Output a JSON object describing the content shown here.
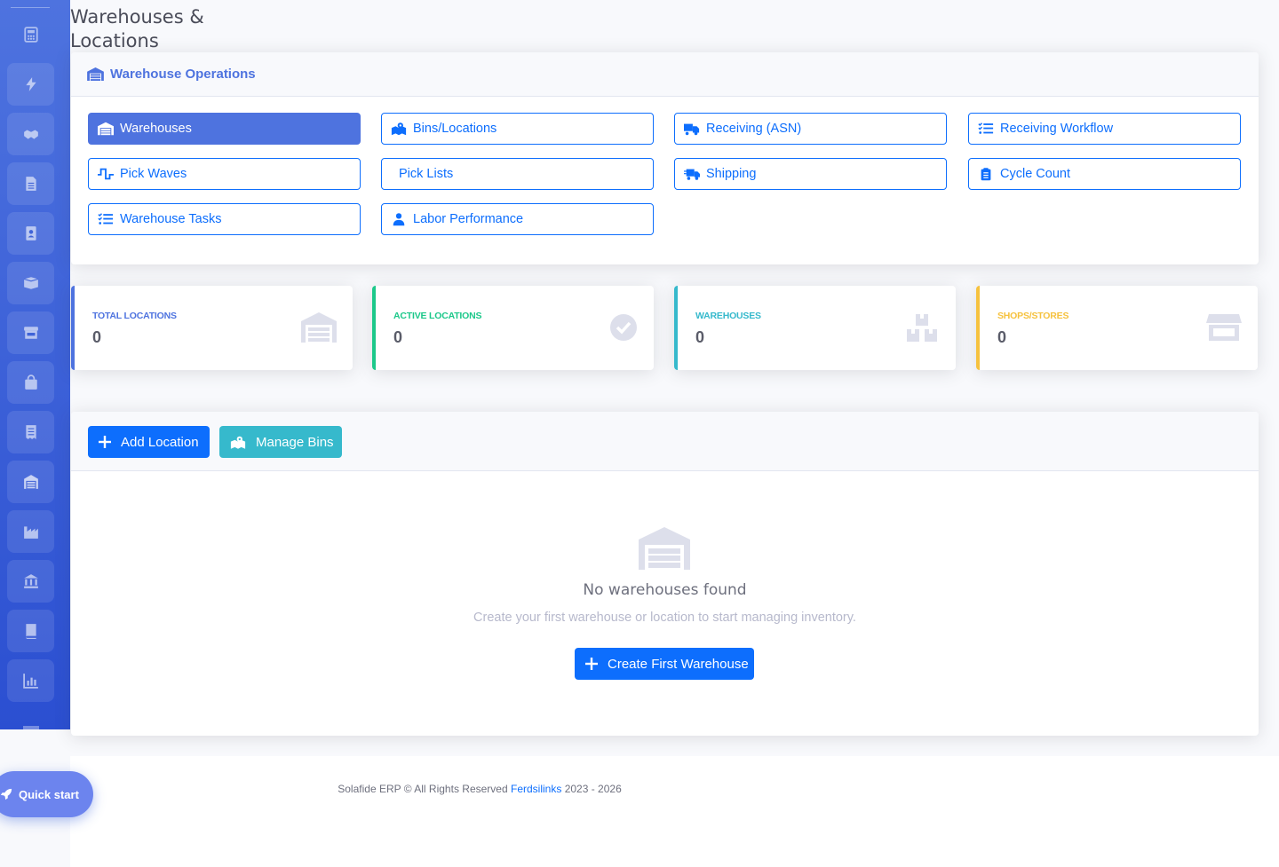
{
  "page": {
    "title": "Warehouses & Locations"
  },
  "sidebar": {
    "items": [
      {
        "icon": "calculator-icon"
      },
      {
        "icon": "bolt-icon"
      },
      {
        "icon": "handshake-icon"
      },
      {
        "icon": "file-icon"
      },
      {
        "icon": "contact-book-icon"
      },
      {
        "icon": "boxes-icon"
      },
      {
        "icon": "store-icon"
      },
      {
        "icon": "shopping-bag-icon"
      },
      {
        "icon": "receipt-icon"
      },
      {
        "icon": "warehouse-icon"
      },
      {
        "icon": "industry-icon"
      },
      {
        "icon": "bank-icon"
      },
      {
        "icon": "book-icon"
      },
      {
        "icon": "chart-icon"
      }
    ]
  },
  "operations": {
    "title": "Warehouse Operations",
    "buttons": [
      {
        "label": "Warehouses",
        "icon": "warehouse-icon",
        "active": true
      },
      {
        "label": "Bins/Locations",
        "icon": "map-marked-icon"
      },
      {
        "label": "Receiving (ASN)",
        "icon": "truck-loading-icon"
      },
      {
        "label": "Receiving Workflow",
        "icon": "tasks-icon"
      },
      {
        "label": "Pick Waves",
        "icon": "wave-square-icon"
      },
      {
        "label": "Pick Lists",
        "icon": "list-icon"
      },
      {
        "label": "Shipping",
        "icon": "shipping-fast-icon"
      },
      {
        "label": "Cycle Count",
        "icon": "clipboard-list-icon"
      },
      {
        "label": "Warehouse Tasks",
        "icon": "tasks-icon"
      },
      {
        "label": "Labor Performance",
        "icon": "user-tie-icon"
      }
    ]
  },
  "stats": [
    {
      "label": "TOTAL LOCATIONS",
      "value": "0",
      "color": "#4e73df",
      "icon": "warehouse-icon"
    },
    {
      "label": "ACTIVE LOCATIONS",
      "value": "0",
      "color": "#1cc88a",
      "icon": "check-circle-icon"
    },
    {
      "label": "WAREHOUSES",
      "value": "0",
      "color": "#36b9cc",
      "icon": "boxes-icon"
    },
    {
      "label": "SHOPS/STORES",
      "value": "0",
      "color": "#f6c23e",
      "icon": "store-icon"
    }
  ],
  "actions": {
    "add_location": "Add Location",
    "manage_bins": "Manage Bins"
  },
  "empty": {
    "title": "No warehouses found",
    "subtitle": "Create your first warehouse or location to start managing inventory.",
    "create_button": "Create First Warehouse"
  },
  "footer": {
    "prefix": "Solafide ERP © All Rights Reserved",
    "link": "Ferdsilinks",
    "years": "2023 - 2026"
  },
  "quick_start": "Quick start",
  "colors": {
    "primary": "#4e73df",
    "button_blue": "#0d6efd",
    "info": "#36b9cc",
    "success": "#1cc88a",
    "warning": "#f6c23e"
  }
}
